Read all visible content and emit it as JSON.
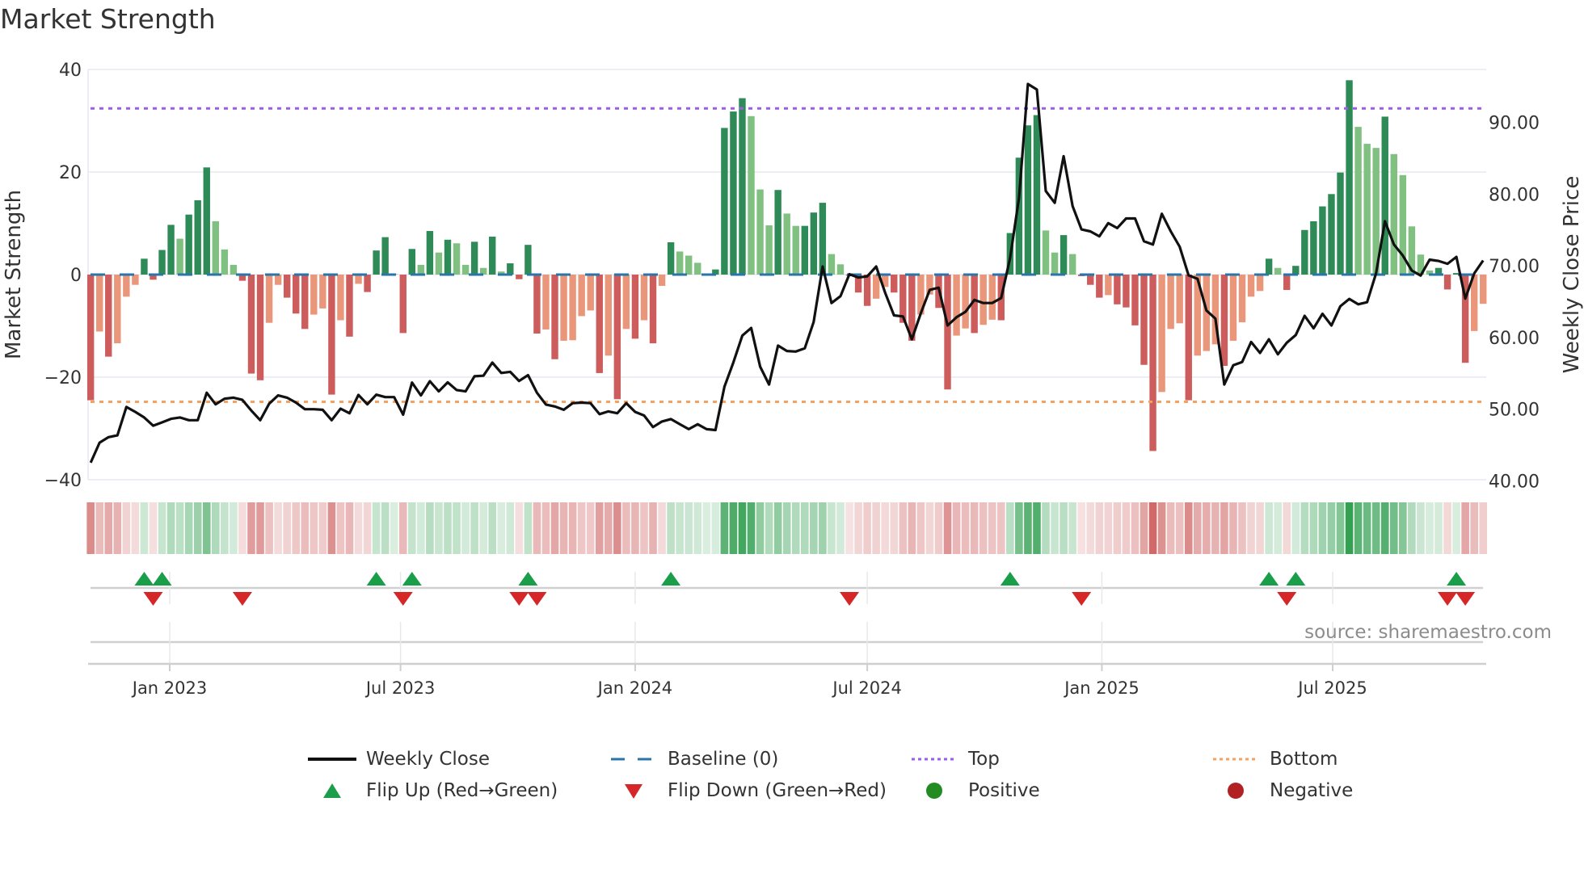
{
  "title": "Market Strength",
  "source": "source: sharemaestro.com",
  "legend": {
    "weekly_close": "Weekly Close",
    "baseline": "Baseline (0)",
    "top": "Top",
    "bottom": "Bottom",
    "flip_up": "Flip Up (Red→Green)",
    "flip_down": "Flip Down (Green→Red)",
    "positive": "Positive",
    "negative": "Negative"
  },
  "colors": {
    "close": "#111111",
    "baseline": "#2b74a8",
    "top": "#9b5de5",
    "bottom": "#f4a261",
    "pos_dark": "#2e8b57",
    "pos_light": "#80c080",
    "neg_dark": "#cd5c5c",
    "neg_light": "#e9967a",
    "flip_up": "#1a9e4a",
    "flip_down": "#d62728",
    "positive": "#228b22",
    "negative": "#b22222"
  },
  "chart_data": {
    "type": "bar",
    "title": "Market Strength",
    "ylabel": "Market Strength",
    "y2label": "Weekly Close Price",
    "ylim": [
      -40,
      40
    ],
    "y2lim": [
      40,
      97
    ],
    "yticks": [
      40,
      20,
      0,
      -20,
      -40
    ],
    "ytick_labels": [
      "40",
      "20",
      "0",
      "−20",
      "−40"
    ],
    "y2ticks": [
      90,
      80,
      70,
      60,
      50,
      40
    ],
    "y2tick_labels": [
      "90.00",
      "80.00",
      "70.00",
      "60.00",
      "50.00",
      "40.00"
    ],
    "xticks": [
      "2023-01-01",
      "2023-07-01",
      "2024-01-01",
      "2024-07-01",
      "2025-01-01",
      "2025-07-01"
    ],
    "xtick_labels": [
      "Jan 2023",
      "Jul 2023",
      "Jan 2024",
      "Jul 2024",
      "Jan 2025",
      "Jul 2025"
    ],
    "x_start": "2022-10-31",
    "x_frequency": "weekly",
    "top_level": 32.4,
    "bottom_level": -24.8,
    "baseline": 0,
    "strength": [
      -24.5,
      -11.1,
      -16,
      -13.4,
      -4.3,
      -2,
      3.1,
      -1,
      4.8,
      9.7,
      7,
      11.7,
      14.5,
      20.9,
      10.4,
      4.9,
      1.9,
      -1.2,
      -19.3,
      -20.6,
      -9.4,
      -2,
      -4.5,
      -7.6,
      -10.6,
      -7.8,
      -6.6,
      -23.4,
      -8.9,
      -12.1,
      -1.8,
      -3.4,
      4.7,
      7.3,
      0.1,
      -11.4,
      5,
      1.9,
      8.5,
      4.3,
      6.8,
      6.1,
      1.9,
      6.4,
      1.3,
      7.4,
      0.6,
      2.2,
      -0.9,
      5.8,
      -11.5,
      -10.7,
      -16.5,
      -12.9,
      -12.8,
      -8.1,
      -7,
      -19.2,
      -15.8,
      -24.3,
      -10.6,
      -12.5,
      -8.9,
      -13.4,
      -2.2,
      6.3,
      4.5,
      3.7,
      2.3,
      0.1,
      1,
      28.6,
      31.8,
      34.4,
      30.9,
      16.6,
      9.6,
      16.5,
      11.9,
      9.5,
      9.5,
      12.1,
      14,
      4,
      2,
      -0.2,
      -3.5,
      -6.1,
      -4.7,
      -2.4,
      -3.5,
      -9.4,
      -12.9,
      -7.8,
      -3.9,
      -6.5,
      -22.4,
      -11.9,
      -10.5,
      -11.4,
      -9.8,
      -8.8,
      -8.9,
      8.1,
      22.8,
      29.1,
      31.1,
      8.6,
      4.3,
      7.7,
      4,
      -0.3,
      -2,
      -4.5,
      -4,
      -5.8,
      -6.4,
      -9.9,
      -17.6,
      -34.4,
      -22.9,
      -10.6,
      -9.5,
      -24.5,
      -15.8,
      -14.9,
      -13.6,
      -17.8,
      -12.9,
      -9.3,
      -4.3,
      -3.2,
      3.1,
      1.3,
      -3,
      1.7,
      8.7,
      10.4,
      13.3,
      15.7,
      19.9,
      37.9,
      28.8,
      25.5,
      24.7,
      30.8,
      23.5,
      19.4,
      9.4,
      3.9,
      0.8,
      1.3,
      -2.9,
      0.3,
      -17.2,
      -11,
      -5.7
    ],
    "weekly_close": [
      42.52,
      45.31,
      46.08,
      46.34,
      50.29,
      49.6,
      48.83,
      47.68,
      48.14,
      48.64,
      48.83,
      48.45,
      48.45,
      52.28,
      50.67,
      51.44,
      51.59,
      51.28,
      49.79,
      48.45,
      50.75,
      51.9,
      51.59,
      50.9,
      49.98,
      49.98,
      49.9,
      48.45,
      50.06,
      49.41,
      51.97,
      50.67,
      52.01,
      51.67,
      51.67,
      49.22,
      53.7,
      51.9,
      53.89,
      52.47,
      53.73,
      52.66,
      52.47,
      54.58,
      54.65,
      56.49,
      55.04,
      55.19,
      53.92,
      54.73,
      52.28,
      50.63,
      50.36,
      49.9,
      50.82,
      50.9,
      50.82,
      49.29,
      49.67,
      49.41,
      50.82,
      49.6,
      49.1,
      47.49,
      48.26,
      48.6,
      47.88,
      47.19,
      47.88,
      47.19,
      47.07,
      53.12,
      56.49,
      60.24,
      61.31,
      55.91,
      53.43,
      58.86,
      58.1,
      58.02,
      58.48,
      62.16,
      69.89,
      64.8,
      65.75,
      68.82,
      68.36,
      68.51,
      69.89,
      66.25,
      63.07,
      62.92,
      59.74,
      63.38,
      66.63,
      66.94,
      61.66,
      62.81,
      63.57,
      65.22,
      64.8,
      64.8,
      65.49,
      71.04,
      79.46,
      95.35,
      94.58,
      80.42,
      78.77,
      85.28,
      78.31,
      75.06,
      74.79,
      74.1,
      75.94,
      75.25,
      76.59,
      76.59,
      73.41,
      72.95,
      77.24,
      74.79,
      72.65,
      68.66,
      68.17,
      63.76,
      62.62,
      53.43,
      56.11,
      56.57,
      59.36,
      57.83,
      59.74,
      57.64,
      59.25,
      60.32,
      63,
      61.27,
      63.3,
      61.66,
      64.34,
      65.37,
      64.61,
      64.91,
      68.93,
      76.21,
      72.95,
      71.42,
      69.32,
      68.63,
      70.85,
      70.66,
      70.27,
      71.23,
      65.41,
      68.93,
      70.73
    ]
  }
}
